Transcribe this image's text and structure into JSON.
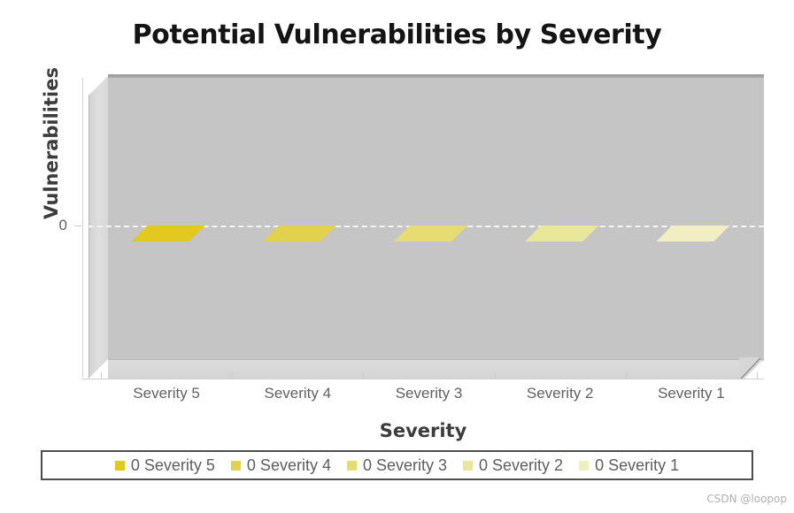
{
  "chart_data": {
    "type": "bar",
    "title": "Potential Vulnerabilities by Severity",
    "xlabel": "Severity",
    "ylabel": "Vulnerabilities",
    "categories": [
      "Severity 5",
      "Severity 4",
      "Severity 3",
      "Severity 2",
      "Severity 1"
    ],
    "values": [
      0,
      0,
      0,
      0,
      0
    ],
    "ytick_labels": [
      "0"
    ],
    "ylim": [
      0,
      0
    ],
    "grid": true,
    "grid_color": "#f4f4f4",
    "legend_position": "bottom",
    "style": "3d-bar",
    "plot_background": "#c5c5c5",
    "series": [
      {
        "name": "Severity 5",
        "values": [
          0
        ],
        "color": "#e3c91f"
      },
      {
        "name": "Severity 4",
        "values": [
          0
        ],
        "color": "#e1d14c"
      },
      {
        "name": "Severity 3",
        "values": [
          0
        ],
        "color": "#e5dd72"
      },
      {
        "name": "Severity 2",
        "values": [
          0
        ],
        "color": "#e9e89a"
      },
      {
        "name": "Severity 1",
        "values": [
          0
        ],
        "color": "#efefc2"
      }
    ],
    "legend": [
      {
        "label": "0 Severity 5",
        "color": "#e3c91f"
      },
      {
        "label": "0 Severity 4",
        "color": "#e1d14c"
      },
      {
        "label": "0 Severity 3",
        "color": "#e5dd72"
      },
      {
        "label": "0 Severity 2",
        "color": "#e9e89a"
      },
      {
        "label": "0 Severity 1",
        "color": "#efefc2"
      }
    ]
  },
  "watermark": "CSDN @loopop"
}
